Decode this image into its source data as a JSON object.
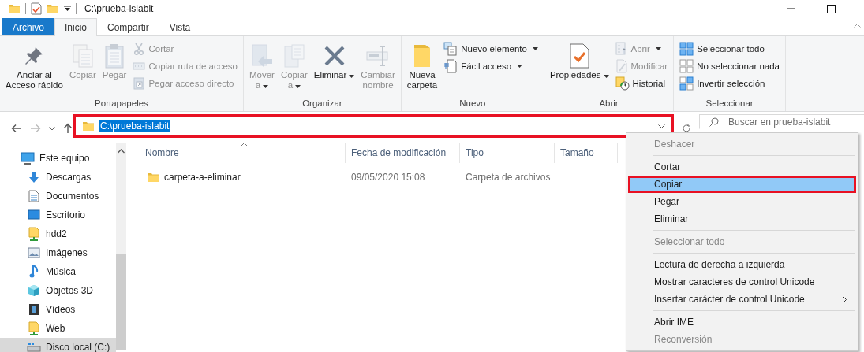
{
  "window": {
    "title": "C:\\prueba-islabit"
  },
  "ribbon_tabs": [
    {
      "label": "Archivo",
      "kind": "file",
      "selected": false
    },
    {
      "label": "Inicio",
      "kind": "tab",
      "selected": true
    },
    {
      "label": "Compartir",
      "kind": "tab",
      "selected": false
    },
    {
      "label": "Vista",
      "kind": "tab",
      "selected": false
    }
  ],
  "ribbon_groups": [
    {
      "label": "Portapapeles",
      "items": [
        {
          "kind": "large",
          "lines": [
            "Anclar al",
            "Acceso rápido"
          ],
          "disabled": false
        },
        {
          "kind": "large",
          "lines": [
            "Copiar"
          ],
          "disabled": true
        },
        {
          "kind": "large",
          "lines": [
            "Pegar"
          ],
          "disabled": true
        },
        {
          "kind": "stack",
          "items": [
            {
              "label": "Cortar",
              "disabled": true
            },
            {
              "label": "Copiar ruta de acceso",
              "disabled": true
            },
            {
              "label": "Pegar acceso directo",
              "disabled": true
            }
          ]
        }
      ]
    },
    {
      "label": "Organizar",
      "items": [
        {
          "kind": "large",
          "lines": [
            "Mover",
            "a"
          ],
          "disabled": true,
          "dropdown": true
        },
        {
          "kind": "large",
          "lines": [
            "Copiar",
            "a"
          ],
          "disabled": true,
          "dropdown": true
        },
        {
          "kind": "large",
          "lines": [
            "Eliminar"
          ],
          "disabled": false,
          "dropdown": true
        },
        {
          "kind": "large",
          "lines": [
            "Cambiar",
            "nombre"
          ],
          "disabled": true
        }
      ]
    },
    {
      "label": "Nuevo",
      "items": [
        {
          "kind": "large",
          "lines": [
            "Nueva",
            "carpeta"
          ],
          "disabled": false
        },
        {
          "kind": "stack",
          "items": [
            {
              "label": "Nuevo elemento",
              "disabled": false,
              "dropdown": true
            },
            {
              "label": "Fácil acceso",
              "disabled": false,
              "dropdown": true
            }
          ]
        }
      ]
    },
    {
      "label": "Abrir",
      "items": [
        {
          "kind": "large",
          "lines": [
            "Propiedades"
          ],
          "disabled": false,
          "dropdown": true
        },
        {
          "kind": "stack",
          "items": [
            {
              "label": "Abrir",
              "disabled": true,
              "dropdown": true
            },
            {
              "label": "Modificar",
              "disabled": true
            },
            {
              "label": "Historial",
              "disabled": false
            }
          ]
        }
      ]
    },
    {
      "label": "Seleccionar",
      "items": [
        {
          "kind": "stack",
          "items": [
            {
              "label": "Seleccionar todo",
              "disabled": false
            },
            {
              "label": "No seleccionar nada",
              "disabled": false
            },
            {
              "label": "Invertir selección",
              "disabled": false
            }
          ]
        }
      ]
    }
  ],
  "address_bar": {
    "path": "C:\\prueba-islabit",
    "text_selected": true,
    "highlighted": true
  },
  "search": {
    "placeholder": "Buscar en prueba-islabit"
  },
  "sidebar": {
    "items": [
      {
        "label": "Este equipo",
        "selected": false,
        "children": [
          {
            "label": "Descargas",
            "selected": false
          },
          {
            "label": "Documentos",
            "selected": false
          },
          {
            "label": "Escritorio",
            "selected": false
          },
          {
            "label": "hdd2",
            "selected": false
          },
          {
            "label": "Imágenes",
            "selected": false
          },
          {
            "label": "Música",
            "selected": false
          },
          {
            "label": "Objetos 3D",
            "selected": false
          },
          {
            "label": "Vídeos",
            "selected": false
          },
          {
            "label": "Web",
            "selected": false
          },
          {
            "label": "Disco local (C:)",
            "selected": true
          }
        ]
      }
    ]
  },
  "file_list": {
    "columns": [
      "Nombre",
      "Fecha de modificación",
      "Tipo",
      "Tamaño"
    ],
    "rows": [
      {
        "name": "carpeta-a-eliminar",
        "modified": "09/05/2020 15:08",
        "type": "Carpeta de archivos",
        "selected": false
      }
    ]
  },
  "context_menu": {
    "items": [
      {
        "kind": "item",
        "label": "Deshacer",
        "disabled": true,
        "selected": false
      },
      {
        "kind": "separator"
      },
      {
        "kind": "item",
        "label": "Cortar",
        "disabled": false,
        "selected": false
      },
      {
        "kind": "item",
        "label": "Copiar",
        "disabled": false,
        "selected": true,
        "highlighted": true
      },
      {
        "kind": "item",
        "label": "Pegar",
        "disabled": false,
        "selected": false
      },
      {
        "kind": "item",
        "label": "Eliminar",
        "disabled": false,
        "selected": false
      },
      {
        "kind": "separator"
      },
      {
        "kind": "item",
        "label": "Seleccionar todo",
        "disabled": true,
        "selected": false
      },
      {
        "kind": "separator"
      },
      {
        "kind": "item",
        "label": "Lectura de derecha a izquierda",
        "disabled": false,
        "selected": false
      },
      {
        "kind": "item",
        "label": "Mostrar caracteres de control Unicode",
        "disabled": false,
        "selected": false
      },
      {
        "kind": "item",
        "label": "Insertar carácter de control Unicode",
        "disabled": false,
        "selected": false,
        "submenu": true
      },
      {
        "kind": "separator"
      },
      {
        "kind": "item",
        "label": "Abrir IME",
        "disabled": false,
        "selected": false
      },
      {
        "kind": "item",
        "label": "Reconversión",
        "disabled": true,
        "selected": false
      }
    ]
  }
}
